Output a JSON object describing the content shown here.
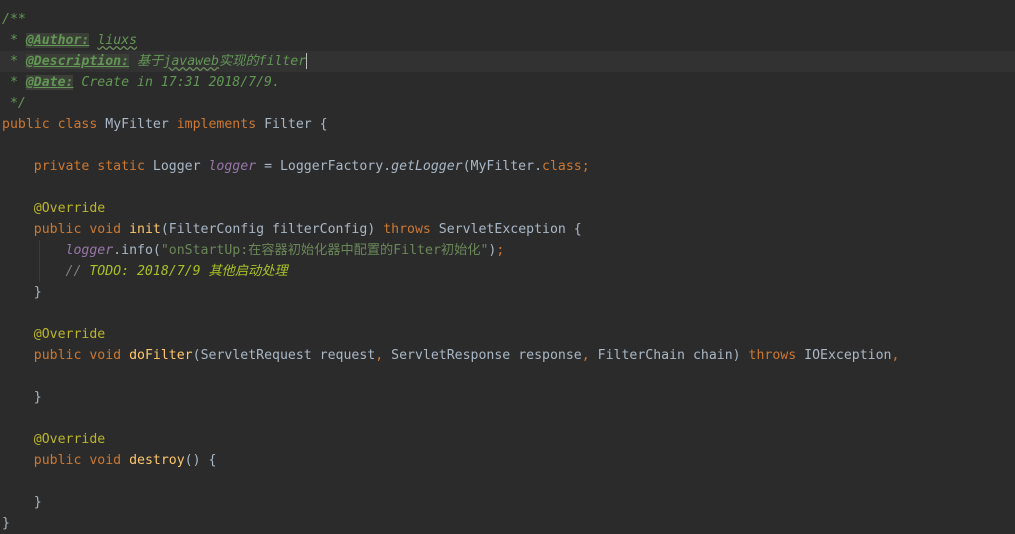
{
  "editor": {
    "lines": [
      "/**",
      " * @Author: liuxs",
      " * @Description: 基于javaweb实现的filter",
      " * @Date: Create in 17:31 2018/7/9.",
      " */",
      "public class MyFilter implements Filter {",
      "",
      "    private static Logger logger = LoggerFactory.getLogger(MyFilter.class);",
      "",
      "    @Override",
      "    public void init(FilterConfig filterConfig) throws ServletException {",
      "        logger.info(\"onStartUp:在容器初始化器中配置的Filter初始化\");",
      "        // TODO: 2018/7/9 其他启动处理",
      "    }",
      "",
      "    @Override",
      "    public void doFilter(ServletRequest request, ServletResponse response, FilterChain chain) throws IOException,",
      "",
      "    }",
      "",
      "    @Override",
      "    public void destroy() {",
      "",
      "    }",
      "}"
    ],
    "tokens": {
      "doc_open": "/**",
      "star": " * ",
      "author_tag": "@Author:",
      "author_value": "liuxs",
      "desc_tag": "@Description:",
      "desc_value_1": "基于",
      "desc_value_2": "javaweb",
      "desc_value_3": "实现的",
      "desc_value_4": "filter",
      "date_tag": "@Date:",
      "date_value": "Create in 17:31 2018/7/9.",
      "doc_close": " */",
      "kw_public": "public",
      "kw_class": "class",
      "class_name": "MyFilter",
      "kw_implements": "implements",
      "iface": "Filter",
      "kw_private": "private",
      "kw_static": "static",
      "type_logger": "Logger",
      "field_logger": "logger",
      "factory": "LoggerFactory",
      "get_logger": "getLogger",
      "kw_class_lit": "class",
      "annotation": "@Override",
      "kw_void": "void",
      "m_init": "init",
      "t_filter_config": "FilterConfig",
      "p_filter_config": "filterConfig",
      "kw_throws": "throws",
      "t_servlet_exc": "ServletException",
      "m_info": "info",
      "info_string": "\"onStartUp:在容器初始化器中配置的Filter初始化\"",
      "todo_prefix": "// ",
      "todo_text": "TODO: 2018/7/9 其他启动处理",
      "m_do_filter": "doFilter",
      "t_request": "ServletRequest",
      "p_request": "request",
      "t_response": "ServletResponse",
      "p_response": "response",
      "t_chain": "FilterChain",
      "p_chain": "chain",
      "t_io_exc": "IOException",
      "m_destroy": "destroy"
    }
  }
}
